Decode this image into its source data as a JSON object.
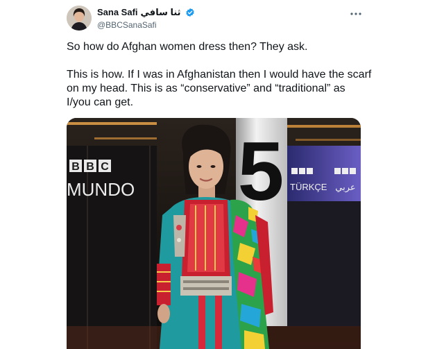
{
  "tweet": {
    "author_name": "Sana Safi",
    "author_name_native": "ثنا سافي",
    "handle": "@BBCSanaSafi",
    "paragraph_1": "So how do Afghan women dress then? They ask.",
    "paragraph_2": "This is how. If I was in Afghanistan then I would have the scarf on my head. This is as “conservative” and “traditional” as I/you can get.",
    "verified_color": "#1d9bf0",
    "more_icon": "more-horizontal-icon"
  },
  "photo": {
    "sign_bbc": "BBC",
    "sign_mundo": "MUNDO",
    "sign_bbc_small_1": "BBC",
    "sign_turkce": "TÜRKÇE",
    "sign_bbc_small_2": "BBC",
    "sign_arabic": "عربي",
    "pillar_number": "5"
  }
}
